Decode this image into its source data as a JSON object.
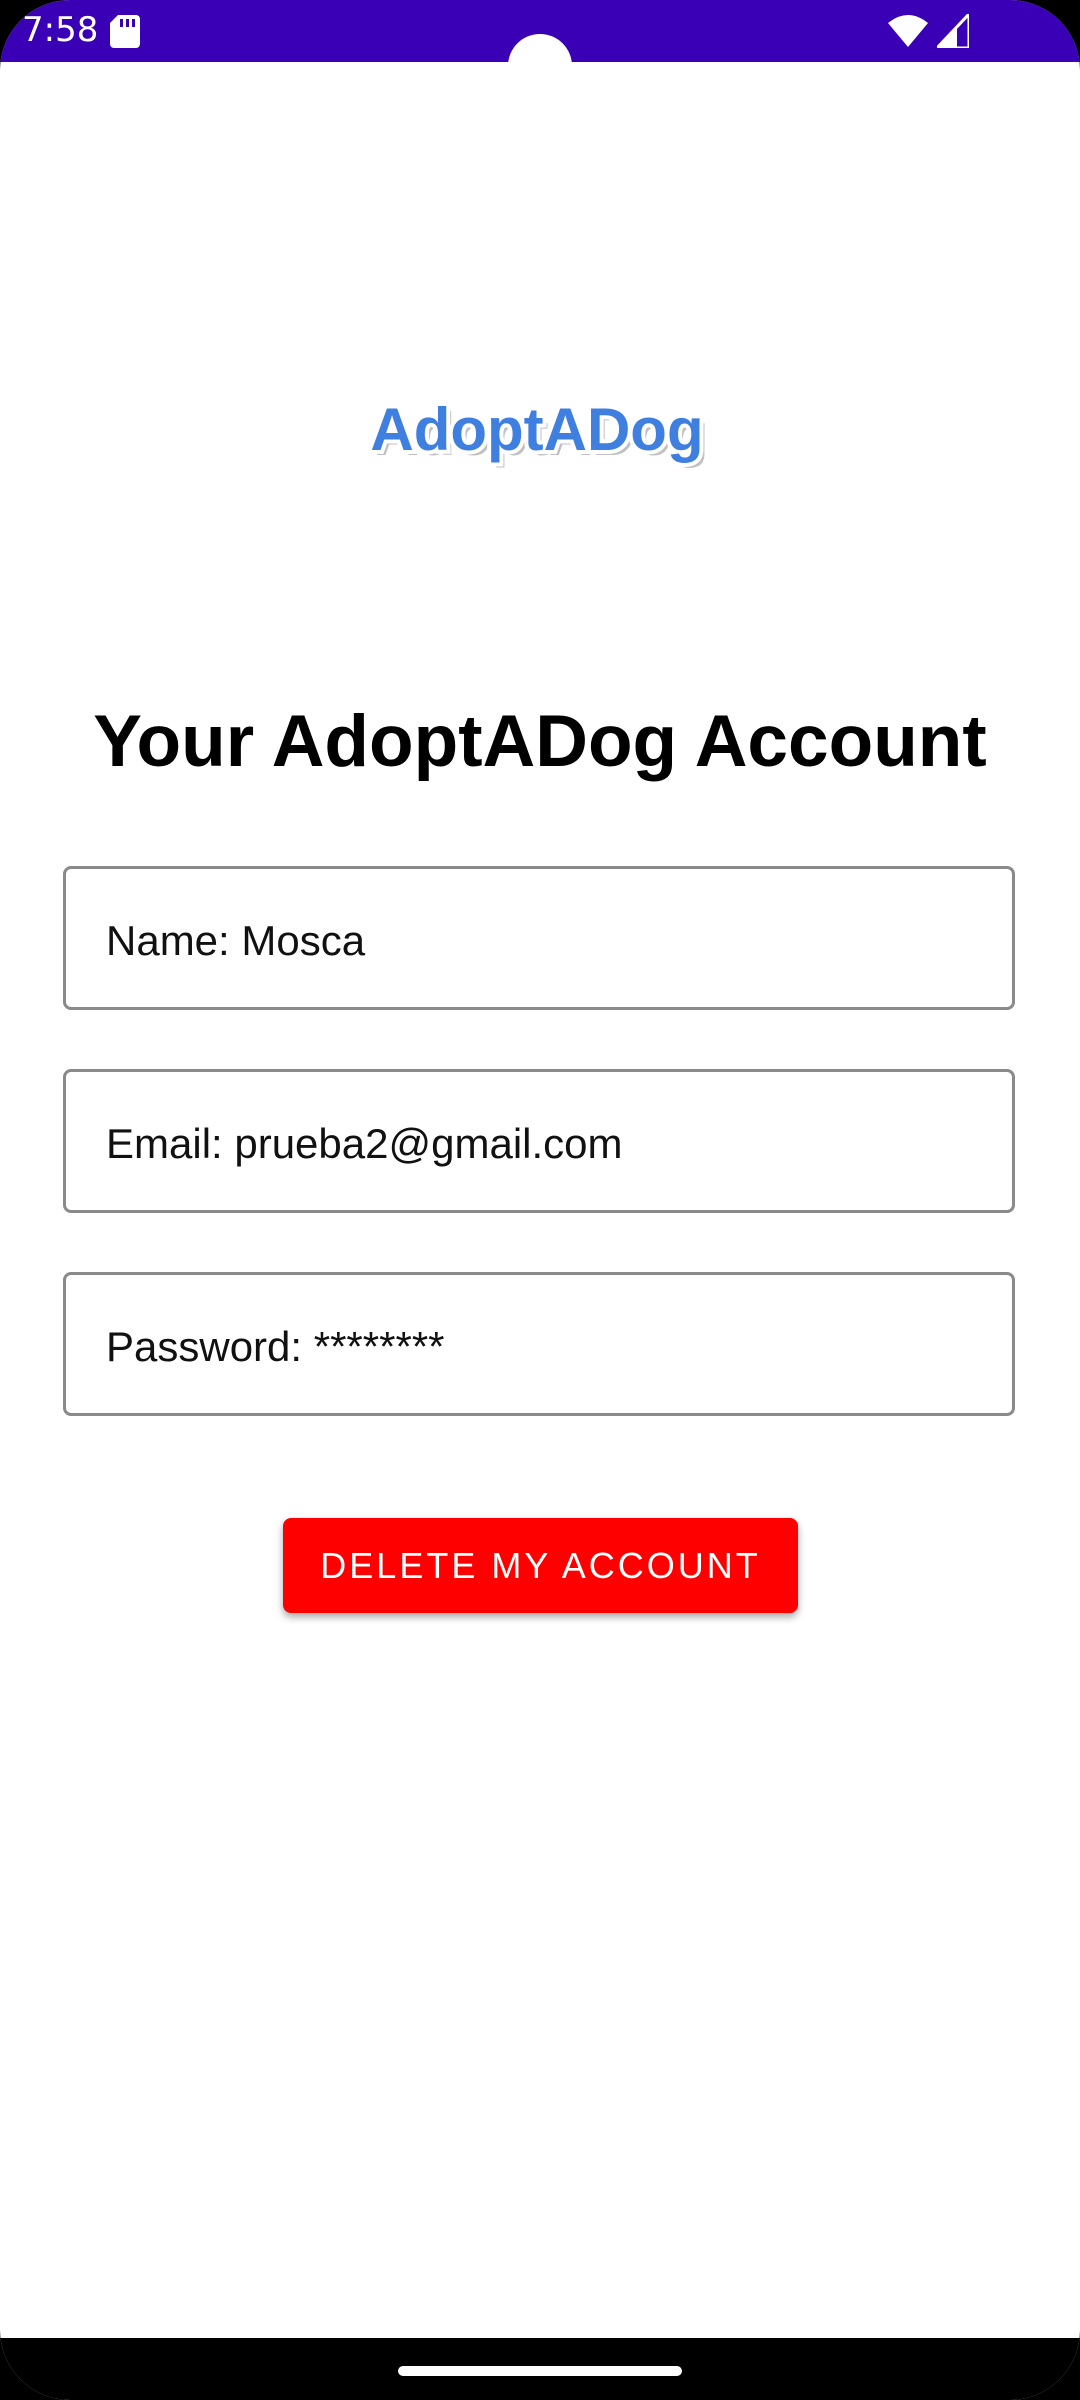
{
  "status_bar": {
    "time": "7:58",
    "background_color": "#3a00b5",
    "icons": [
      "sd-card-icon",
      "wifi-icon",
      "cell-signal-icon"
    ]
  },
  "logo": {
    "text": "AdoptADog",
    "color": "#3f7fe0"
  },
  "page_title": "Your AdoptADog Account",
  "fields": {
    "name": "Name: Mosca",
    "email": "Email: prueba2@gmail.com",
    "password": "Password: ********"
  },
  "delete_button": {
    "label": "DELETE MY ACCOUNT",
    "color": "#ff0000"
  }
}
